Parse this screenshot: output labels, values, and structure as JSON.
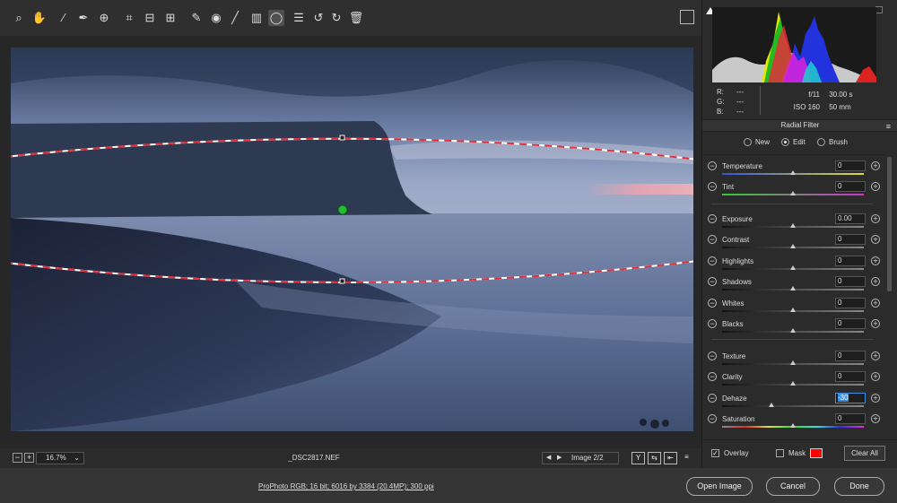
{
  "toolbar": {
    "tools": [
      {
        "name": "zoom-tool",
        "icon": "magnifier-icon",
        "glyph": "⌕"
      },
      {
        "name": "hand-tool",
        "icon": "hand-icon",
        "glyph": "✋"
      },
      {
        "name": "white-balance-tool",
        "icon": "eyedropper-icon",
        "glyph": "⁄"
      },
      {
        "name": "color-sampler-tool",
        "icon": "sampler-eyedropper-icon",
        "glyph": "✒"
      },
      {
        "name": "targeted-adjustment-tool",
        "icon": "target-adjust-icon",
        "glyph": "⊕"
      },
      {
        "name": "crop-tool",
        "icon": "crop-icon",
        "glyph": "⌗"
      },
      {
        "name": "straighten-tool",
        "icon": "straighten-icon",
        "glyph": "⊟"
      },
      {
        "name": "transform-tool",
        "icon": "transform-icon",
        "glyph": "⊞"
      },
      {
        "name": "spot-removal-tool",
        "icon": "spot-removal-icon",
        "glyph": "✎"
      },
      {
        "name": "red-eye-tool",
        "icon": "red-eye-icon",
        "glyph": "◉"
      },
      {
        "name": "adjustment-brush-tool",
        "icon": "brush-icon",
        "glyph": "╱"
      },
      {
        "name": "graduated-filter-tool",
        "icon": "graduated-filter-icon",
        "glyph": "▥"
      },
      {
        "name": "radial-filter-tool",
        "icon": "radial-filter-icon",
        "glyph": "◯"
      },
      {
        "name": "preferences-tool",
        "icon": "list-icon",
        "glyph": "☰"
      },
      {
        "name": "rotate-left-tool",
        "icon": "rotate-ccw-icon",
        "glyph": "↺"
      },
      {
        "name": "rotate-right-tool",
        "icon": "rotate-cw-icon",
        "glyph": "↻"
      },
      {
        "name": "delete-tool",
        "icon": "trash-icon",
        "glyph": "🗑"
      }
    ],
    "active_tool": "radial-filter-tool"
  },
  "status": {
    "zoom": "16.7%",
    "filename": "_DSC2817.NEF",
    "image_counter": "Image 2/2",
    "view_buttons": [
      "Y",
      "⇆",
      "⇤",
      "≡"
    ]
  },
  "bottom": {
    "workflow_options": "ProPhoto RGB; 16 bit; 6016 by 3384 (20.4MP); 300 ppi",
    "open_image": "Open Image",
    "cancel": "Cancel",
    "done": "Done"
  },
  "readouts": {
    "r_label": "R:",
    "r_value": "---",
    "g_label": "G:",
    "g_value": "---",
    "b_label": "B:",
    "b_value": "---",
    "aperture": "f/11",
    "shutter": "30.00 s",
    "iso": "ISO 160",
    "focal": "50 mm"
  },
  "panel": {
    "title": "Radial Filter",
    "modes": [
      {
        "label": "New",
        "selected": false
      },
      {
        "label": "Edit",
        "selected": true
      },
      {
        "label": "Brush",
        "selected": false
      }
    ],
    "sliders": [
      {
        "label": "Temperature",
        "value": "0",
        "pos": 0.5,
        "track": "temp"
      },
      {
        "label": "Tint",
        "value": "0",
        "pos": 0.5,
        "track": "tint"
      },
      {
        "label": "Exposure",
        "value": "0.00",
        "pos": 0.5,
        "track": "gray"
      },
      {
        "label": "Contrast",
        "value": "0",
        "pos": 0.5,
        "track": "gray"
      },
      {
        "label": "Highlights",
        "value": "0",
        "pos": 0.5,
        "track": "gray"
      },
      {
        "label": "Shadows",
        "value": "0",
        "pos": 0.5,
        "track": "gray"
      },
      {
        "label": "Whites",
        "value": "0",
        "pos": 0.5,
        "track": "gray"
      },
      {
        "label": "Blacks",
        "value": "0",
        "pos": 0.5,
        "track": "gray"
      },
      {
        "label": "Texture",
        "value": "0",
        "pos": 0.5,
        "track": "gray"
      },
      {
        "label": "Clarity",
        "value": "0",
        "pos": 0.5,
        "track": "gray"
      },
      {
        "label": "Dehaze",
        "value": "-30",
        "pos": 0.35,
        "track": "gray",
        "selected": true
      },
      {
        "label": "Saturation",
        "value": "0",
        "pos": 0.5,
        "track": "sat"
      }
    ],
    "overlay_label": "Overlay",
    "overlay_checked": true,
    "mask_label": "Mask",
    "mask_checked": false,
    "mask_color": "#ff0000",
    "clear_all": "Clear All"
  },
  "colors": {
    "filter_line_red": "#e0303a",
    "pin_green": "#22bb33",
    "selection_blue": "#3a8ee6"
  }
}
